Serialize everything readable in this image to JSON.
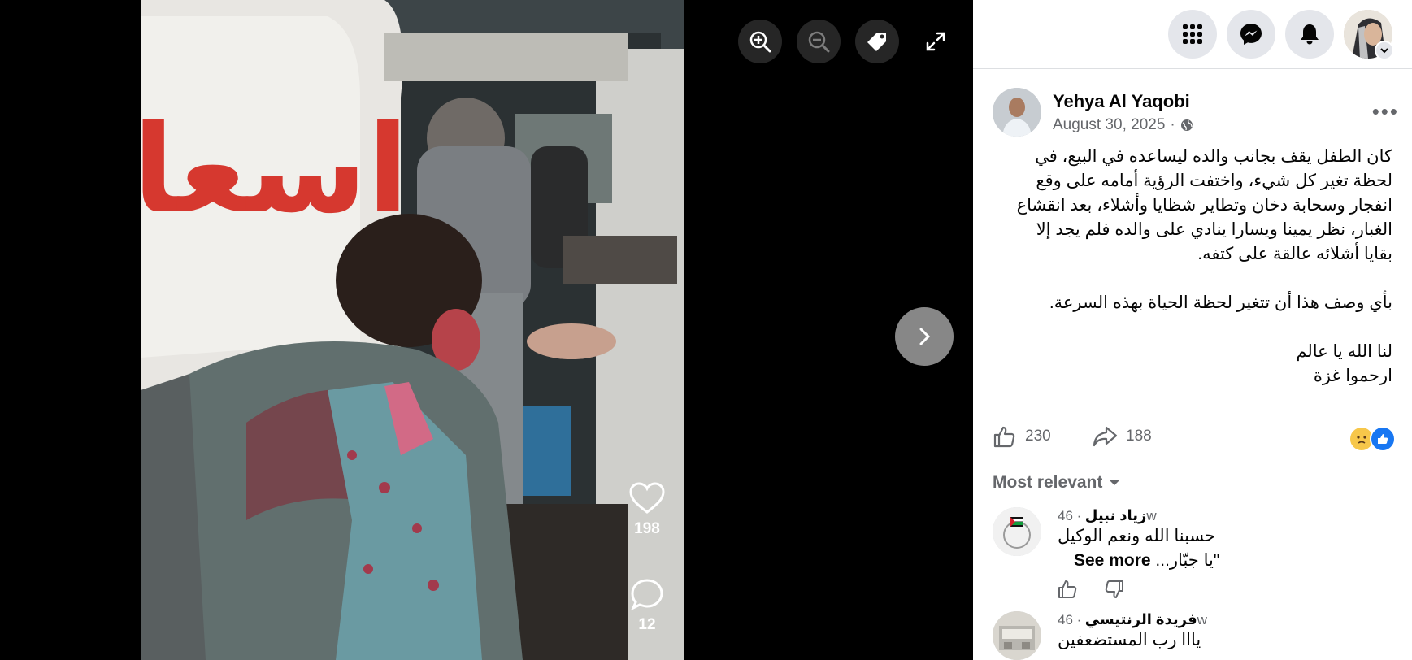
{
  "viewer": {
    "tools": {
      "zoom_in": "zoom-in-icon",
      "zoom_out": "zoom-out-icon",
      "tag": "tag-icon",
      "fullscreen": "fullscreen-icon"
    },
    "next": "chevron-right-icon",
    "overlay": {
      "likes": "198",
      "comments": "12"
    },
    "ambulance_text": "اسعا"
  },
  "topbar": {
    "menu": "grid-menu-icon",
    "messenger": "messenger-icon",
    "notifications": "bell-icon",
    "account": "account-chevron-icon"
  },
  "post": {
    "author": "Yehya Al Yaqobi",
    "date": "August 30, 2025",
    "privacy": "globe-icon",
    "text": {
      "p1_l1": "كان الطفل يقف بجانب والده ليساعده في البيع، في",
      "p1_l2": "لحظة تغير كل شيء، واختفت الرؤية أمامه على وقع",
      "p1_l3": "انفجار وسحابة دخان وتطاير شظايا وأشلاء، بعد انقشاع",
      "p1_l4": "الغبار، نظر يمينا ويسارا ينادي على والده فلم يجد إلا",
      "p1_l5": "بقايا أشلائه عالقة على كتفه.",
      "p2": "بأي وصف هذا أن تتغير لحظة الحياة بهذه السرعة.",
      "p3_l1": "لنا الله يا عالم",
      "p3_l2": "ارحموا غزة"
    },
    "likes": "230",
    "shares": "188"
  },
  "comments": {
    "sort_label": "Most relevant",
    "items": [
      {
        "name": "زياد نبيل",
        "time": "· 46w",
        "line1": "حسبنا الله ونعم الوكيل",
        "line2": "\"يا جبّار...",
        "see_more": "See more"
      },
      {
        "name": "فريدة الرنتيسي",
        "time": "· 46w",
        "line1": "يااا رب المستضعفين"
      }
    ]
  },
  "colors": {
    "accent": "#1877f2",
    "text": "#050505",
    "muted": "#65676b"
  }
}
